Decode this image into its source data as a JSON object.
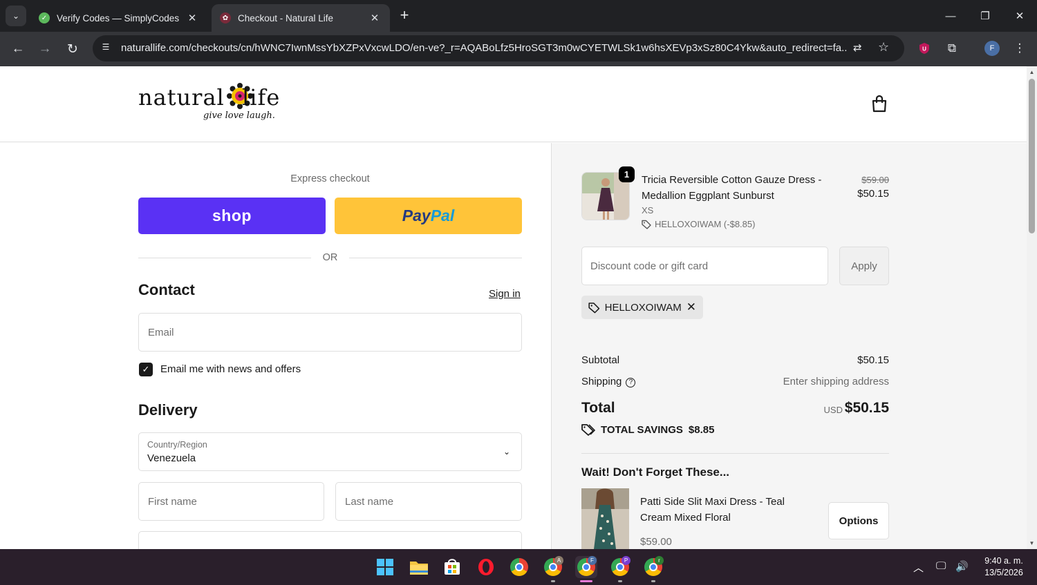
{
  "browser": {
    "tabs": [
      {
        "title": "Verify Codes — SimplyCodes",
        "active": false
      },
      {
        "title": "Checkout - Natural Life",
        "active": true
      }
    ],
    "url": "naturallife.com/checkouts/cn/hWNC7IwnMssYbXZPxVxcwLDO/en-ve?_r=AQABoLfz5HroSGT3m0wCYETWLSk1w6hsXEVp3xSz80C4Ykw&auto_redirect=fa...",
    "profile_initial": "F"
  },
  "header": {
    "logo_word1": "natural",
    "logo_word2": "life",
    "logo_tagline": "give love laugh."
  },
  "checkout": {
    "express_title": "Express checkout",
    "shop_label": "shop",
    "paypal_label_1": "Pay",
    "paypal_label_2": "Pal",
    "or_label": "OR",
    "contact_title": "Contact",
    "sign_in": "Sign in",
    "email_placeholder": "Email",
    "newsletter_label": "Email me with news and offers",
    "newsletter_checked": true,
    "delivery_title": "Delivery",
    "country_label": "Country/Region",
    "country_value": "Venezuela",
    "first_name_placeholder": "First name",
    "last_name_placeholder": "Last name"
  },
  "summary": {
    "product": {
      "quantity": "1",
      "name": "Tricia Reversible Cotton Gauze Dress - Medallion Eggplant Sunburst",
      "variant": "XS",
      "discount_line": "HELLOXOIWAM (-$8.85)",
      "price_original": "$59.00",
      "price_final": "$50.15"
    },
    "discount_placeholder": "Discount code or gift card",
    "apply_label": "Apply",
    "applied_code": "HELLOXOIWAM",
    "subtotal_label": "Subtotal",
    "subtotal_value": "$50.15",
    "shipping_label": "Shipping",
    "shipping_value": "Enter shipping address",
    "total_label": "Total",
    "total_currency": "USD",
    "total_value": "$50.15",
    "savings_label": "TOTAL SAVINGS",
    "savings_value": "$8.85",
    "upsell_title": "Wait! Don't Forget These...",
    "upsell_name": "Patti Side Slit Maxi Dress - Teal Cream Mixed Floral",
    "upsell_price": "$59.00",
    "upsell_button": "Options"
  },
  "taskbar": {
    "time": "9:40 a. m.",
    "date": "13/5/2026"
  }
}
